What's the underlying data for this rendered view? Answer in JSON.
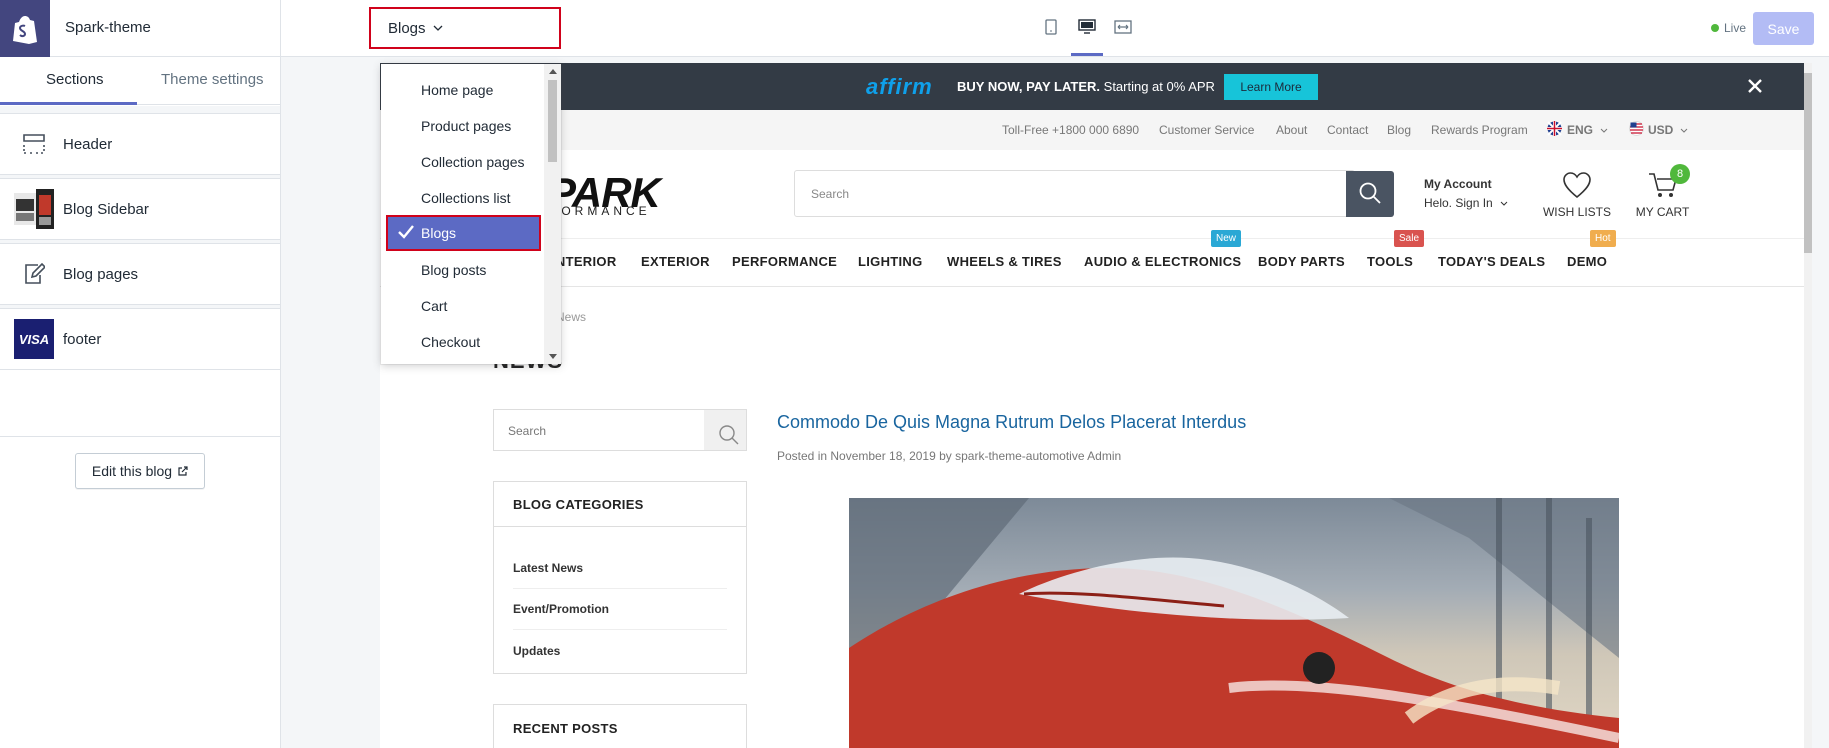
{
  "topbar": {
    "theme_name": "Spark-theme",
    "page_select": "Blogs",
    "live_label": "Live",
    "save_label": "Save",
    "device_icons": [
      "mobile-icon",
      "desktop-icon",
      "fullwidth-icon"
    ]
  },
  "sidebar": {
    "tabs": [
      "Sections",
      "Theme settings"
    ],
    "active_tab": "Sections",
    "items": [
      {
        "label": "Header",
        "icon": "header-layout-icon"
      },
      {
        "label": "Blog Sidebar",
        "icon": "blog-sidebar-thumbnail"
      },
      {
        "label": "Blog pages",
        "icon": "edit-page-icon"
      },
      {
        "label": "footer",
        "icon": "visa-card-icon"
      }
    ],
    "edit_button": "Edit this blog",
    "visa_text": "VISA"
  },
  "dropdown": {
    "items": [
      "Home page",
      "Product pages",
      "Collection pages",
      "Collections list",
      "Blogs",
      "Blog posts",
      "Cart",
      "Checkout"
    ],
    "selected": "Blogs"
  },
  "preview": {
    "promo": {
      "brand": "affirm",
      "text_bold": "BUY NOW, PAY LATER.",
      "text": " Starting at 0% APR",
      "button": "Learn More"
    },
    "topnav": {
      "phone": "Toll-Free +1800 000 6890",
      "links": [
        "Customer Service",
        "About",
        "Contact",
        "Blog",
        "Rewards Program"
      ],
      "language": "ENG",
      "currency": "USD"
    },
    "logo_main": "PARK",
    "logo_sub": "FORMANCE",
    "search_placeholder": "Search",
    "account_title": "My Account",
    "account_sub": "Helo. Sign In",
    "wishlist_label": "WISH LISTS",
    "cart_label": "MY CART",
    "cart_count": "8",
    "main_nav": [
      "INTERIOR",
      "EXTERIOR",
      "PERFORMANCE",
      "LIGHTING",
      "WHEELS & TIRES",
      "AUDIO & ELECTRONICS",
      "BODY PARTS",
      "TOOLS",
      "TODAY'S DEALS",
      "DEMO"
    ],
    "badges": {
      "new": "New",
      "sale": "Sale",
      "hot": "Hot"
    },
    "badge_colors": {
      "new": "#2aa8d5",
      "sale": "#d9534f",
      "hot": "#f0ad4e"
    },
    "breadcrumb": "News",
    "page_title": "NEWS",
    "blog_search_placeholder": "Search",
    "categories_title": "BLOG CATEGORIES",
    "categories": [
      "Latest News",
      "Event/Promotion",
      "Updates"
    ],
    "recent_title": "RECENT POSTS",
    "post_title": "Commodo De Quis Magna Rutrum Delos Placerat Interdus",
    "post_meta": "Posted in November 18, 2019 by spark-theme-automotive Admin"
  },
  "colors": {
    "accent": "#5c6ac4",
    "highlight_border": "#d0021b",
    "shopify_logo_bg": "#43467f",
    "save_disabled": "#b3bcf5",
    "promo_bg": "#333b45",
    "learn_more": "#17c4d9",
    "post_title": "#19659f"
  }
}
